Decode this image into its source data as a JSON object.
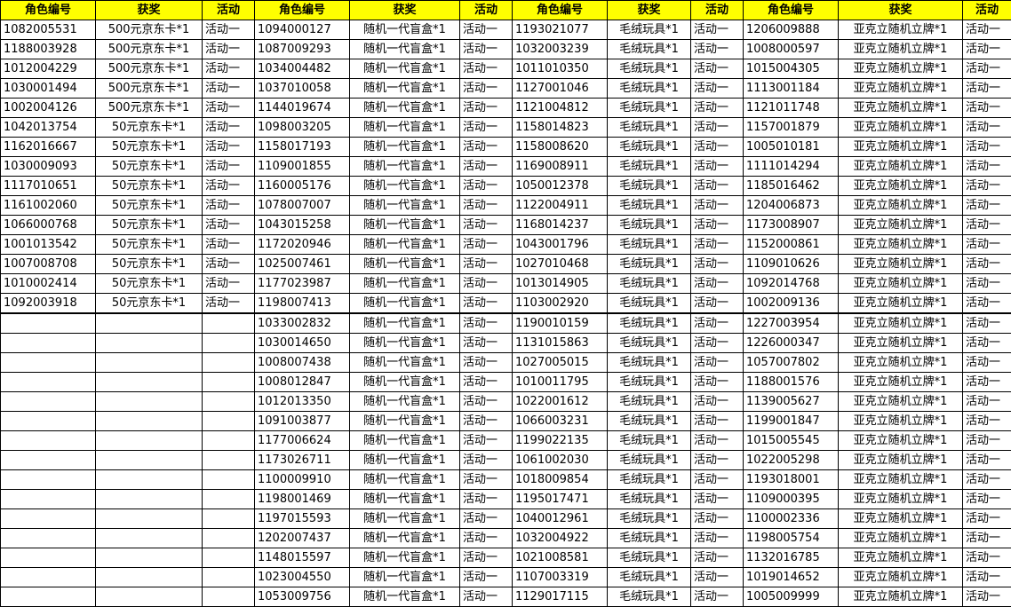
{
  "headers": [
    "角色编号",
    "获奖",
    "活动",
    "角色编号",
    "获奖",
    "活动",
    "角色编号",
    "获奖",
    "活动",
    "角色编号",
    "获奖",
    "活动"
  ],
  "rows": [
    [
      "1082005531",
      "500元京东卡*1",
      "活动一",
      "1094000127",
      "随机一代盲盒*1",
      "活动一",
      "1193021077",
      "毛绒玩具*1",
      "活动一",
      "1206009888",
      "亚克立随机立牌*1",
      "活动一"
    ],
    [
      "1188003928",
      "500元京东卡*1",
      "活动一",
      "1087009293",
      "随机一代盲盒*1",
      "活动一",
      "1032003239",
      "毛绒玩具*1",
      "活动一",
      "1008000597",
      "亚克立随机立牌*1",
      "活动一"
    ],
    [
      "1012004229",
      "500元京东卡*1",
      "活动一",
      "1034004482",
      "随机一代盲盒*1",
      "活动一",
      "1011010350",
      "毛绒玩具*1",
      "活动一",
      "1015004305",
      "亚克立随机立牌*1",
      "活动一"
    ],
    [
      "1030001494",
      "500元京东卡*1",
      "活动一",
      "1037010058",
      "随机一代盲盒*1",
      "活动一",
      "1127001046",
      "毛绒玩具*1",
      "活动一",
      "1113001184",
      "亚克立随机立牌*1",
      "活动一"
    ],
    [
      "1002004126",
      "500元京东卡*1",
      "活动一",
      "1144019674",
      "随机一代盲盒*1",
      "活动一",
      "1121004812",
      "毛绒玩具*1",
      "活动一",
      "1121011748",
      "亚克立随机立牌*1",
      "活动一"
    ],
    [
      "1042013754",
      "50元京东卡*1",
      "活动一",
      "1098003205",
      "随机一代盲盒*1",
      "活动一",
      "1158014823",
      "毛绒玩具*1",
      "活动一",
      "1157001879",
      "亚克立随机立牌*1",
      "活动一"
    ],
    [
      "1162016667",
      "50元京东卡*1",
      "活动一",
      "1158017193",
      "随机一代盲盒*1",
      "活动一",
      "1158008620",
      "毛绒玩具*1",
      "活动一",
      "1005010181",
      "亚克立随机立牌*1",
      "活动一"
    ],
    [
      "1030009093",
      "50元京东卡*1",
      "活动一",
      "1109001855",
      "随机一代盲盒*1",
      "活动一",
      "1169008911",
      "毛绒玩具*1",
      "活动一",
      "1111014294",
      "亚克立随机立牌*1",
      "活动一"
    ],
    [
      "1117010651",
      "50元京东卡*1",
      "活动一",
      "1160005176",
      "随机一代盲盒*1",
      "活动一",
      "1050012378",
      "毛绒玩具*1",
      "活动一",
      "1185016462",
      "亚克立随机立牌*1",
      "活动一"
    ],
    [
      "1161002060",
      "50元京东卡*1",
      "活动一",
      "1078007007",
      "随机一代盲盒*1",
      "活动一",
      "1122004911",
      "毛绒玩具*1",
      "活动一",
      "1204006873",
      "亚克立随机立牌*1",
      "活动一"
    ],
    [
      "1066000768",
      "50元京东卡*1",
      "活动一",
      "1043015258",
      "随机一代盲盒*1",
      "活动一",
      "1168014237",
      "毛绒玩具*1",
      "活动一",
      "1173008907",
      "亚克立随机立牌*1",
      "活动一"
    ],
    [
      "1001013542",
      "50元京东卡*1",
      "活动一",
      "1172020946",
      "随机一代盲盒*1",
      "活动一",
      "1043001796",
      "毛绒玩具*1",
      "活动一",
      "1152000861",
      "亚克立随机立牌*1",
      "活动一"
    ],
    [
      "1007008708",
      "50元京东卡*1",
      "活动一",
      "1025007461",
      "随机一代盲盒*1",
      "活动一",
      "1027010468",
      "毛绒玩具*1",
      "活动一",
      "1109010626",
      "亚克立随机立牌*1",
      "活动一"
    ],
    [
      "1010002414",
      "50元京东卡*1",
      "活动一",
      "1177023987",
      "随机一代盲盒*1",
      "活动一",
      "1013014905",
      "毛绒玩具*1",
      "活动一",
      "1092014768",
      "亚克立随机立牌*1",
      "活动一"
    ],
    [
      "1092003918",
      "50元京东卡*1",
      "活动一",
      "1198007413",
      "随机一代盲盒*1",
      "活动一",
      "1103002920",
      "毛绒玩具*1",
      "活动一",
      "1002009136",
      "亚克立随机立牌*1",
      "活动一"
    ],
    [
      "",
      "",
      "",
      "1033002832",
      "随机一代盲盒*1",
      "活动一",
      "1190010159",
      "毛绒玩具*1",
      "活动一",
      "1227003954",
      "亚克立随机立牌*1",
      "活动一"
    ],
    [
      "",
      "",
      "",
      "1030014650",
      "随机一代盲盒*1",
      "活动一",
      "1131015863",
      "毛绒玩具*1",
      "活动一",
      "1226000347",
      "亚克立随机立牌*1",
      "活动一"
    ],
    [
      "",
      "",
      "",
      "1008007438",
      "随机一代盲盒*1",
      "活动一",
      "1027005015",
      "毛绒玩具*1",
      "活动一",
      "1057007802",
      "亚克立随机立牌*1",
      "活动一"
    ],
    [
      "",
      "",
      "",
      "1008012847",
      "随机一代盲盒*1",
      "活动一",
      "1010011795",
      "毛绒玩具*1",
      "活动一",
      "1188001576",
      "亚克立随机立牌*1",
      "活动一"
    ],
    [
      "",
      "",
      "",
      "1012013350",
      "随机一代盲盒*1",
      "活动一",
      "1022001612",
      "毛绒玩具*1",
      "活动一",
      "1139005627",
      "亚克立随机立牌*1",
      "活动一"
    ],
    [
      "",
      "",
      "",
      "1091003877",
      "随机一代盲盒*1",
      "活动一",
      "1066003231",
      "毛绒玩具*1",
      "活动一",
      "1199001847",
      "亚克立随机立牌*1",
      "活动一"
    ],
    [
      "",
      "",
      "",
      "1177006624",
      "随机一代盲盒*1",
      "活动一",
      "1199022135",
      "毛绒玩具*1",
      "活动一",
      "1015005545",
      "亚克立随机立牌*1",
      "活动一"
    ],
    [
      "",
      "",
      "",
      "1173026711",
      "随机一代盲盒*1",
      "活动一",
      "1061002030",
      "毛绒玩具*1",
      "活动一",
      "1022005298",
      "亚克立随机立牌*1",
      "活动一"
    ],
    [
      "",
      "",
      "",
      "1100009910",
      "随机一代盲盒*1",
      "活动一",
      "1018009854",
      "毛绒玩具*1",
      "活动一",
      "1193018001",
      "亚克立随机立牌*1",
      "活动一"
    ],
    [
      "",
      "",
      "",
      "1198001469",
      "随机一代盲盒*1",
      "活动一",
      "1195017471",
      "毛绒玩具*1",
      "活动一",
      "1109000395",
      "亚克立随机立牌*1",
      "活动一"
    ],
    [
      "",
      "",
      "",
      "1197015593",
      "随机一代盲盒*1",
      "活动一",
      "1040012961",
      "毛绒玩具*1",
      "活动一",
      "1100002336",
      "亚克立随机立牌*1",
      "活动一"
    ],
    [
      "",
      "",
      "",
      "1202007437",
      "随机一代盲盒*1",
      "活动一",
      "1032004922",
      "毛绒玩具*1",
      "活动一",
      "1198005754",
      "亚克立随机立牌*1",
      "活动一"
    ],
    [
      "",
      "",
      "",
      "1148015597",
      "随机一代盲盒*1",
      "活动一",
      "1021008581",
      "毛绒玩具*1",
      "活动一",
      "1132016785",
      "亚克立随机立牌*1",
      "活动一"
    ],
    [
      "",
      "",
      "",
      "1023004550",
      "随机一代盲盒*1",
      "活动一",
      "1107003319",
      "毛绒玩具*1",
      "活动一",
      "1019014652",
      "亚克立随机立牌*1",
      "活动一"
    ],
    [
      "",
      "",
      "",
      "1053009756",
      "随机一代盲盒*1",
      "活动一",
      "1129017115",
      "毛绒玩具*1",
      "活动一",
      "1005009999",
      "亚克立随机立牌*1",
      "活动一"
    ]
  ]
}
